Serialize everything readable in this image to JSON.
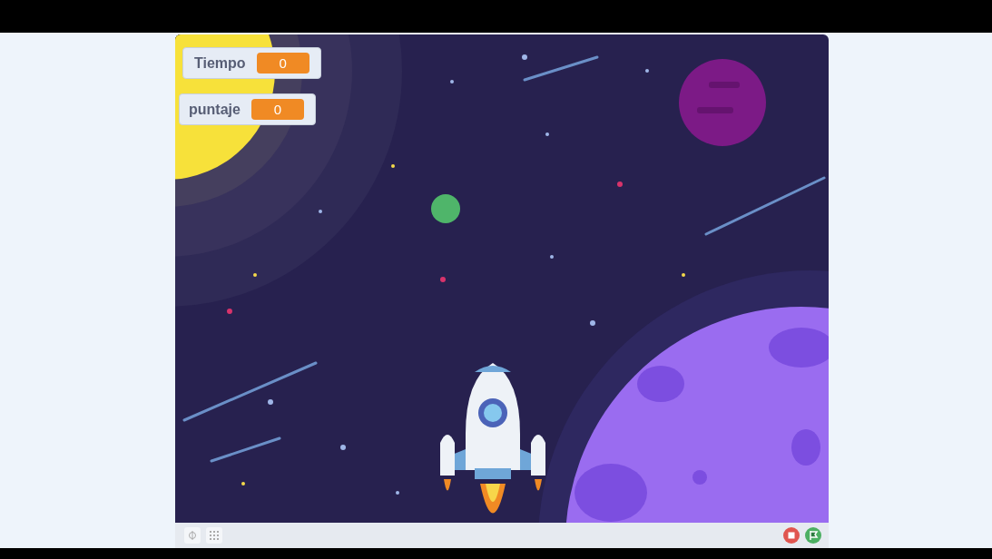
{
  "stage": {
    "monitors": [
      {
        "label": "Tiempo",
        "value": "0"
      },
      {
        "label": "puntaje",
        "value": "0"
      }
    ]
  }
}
